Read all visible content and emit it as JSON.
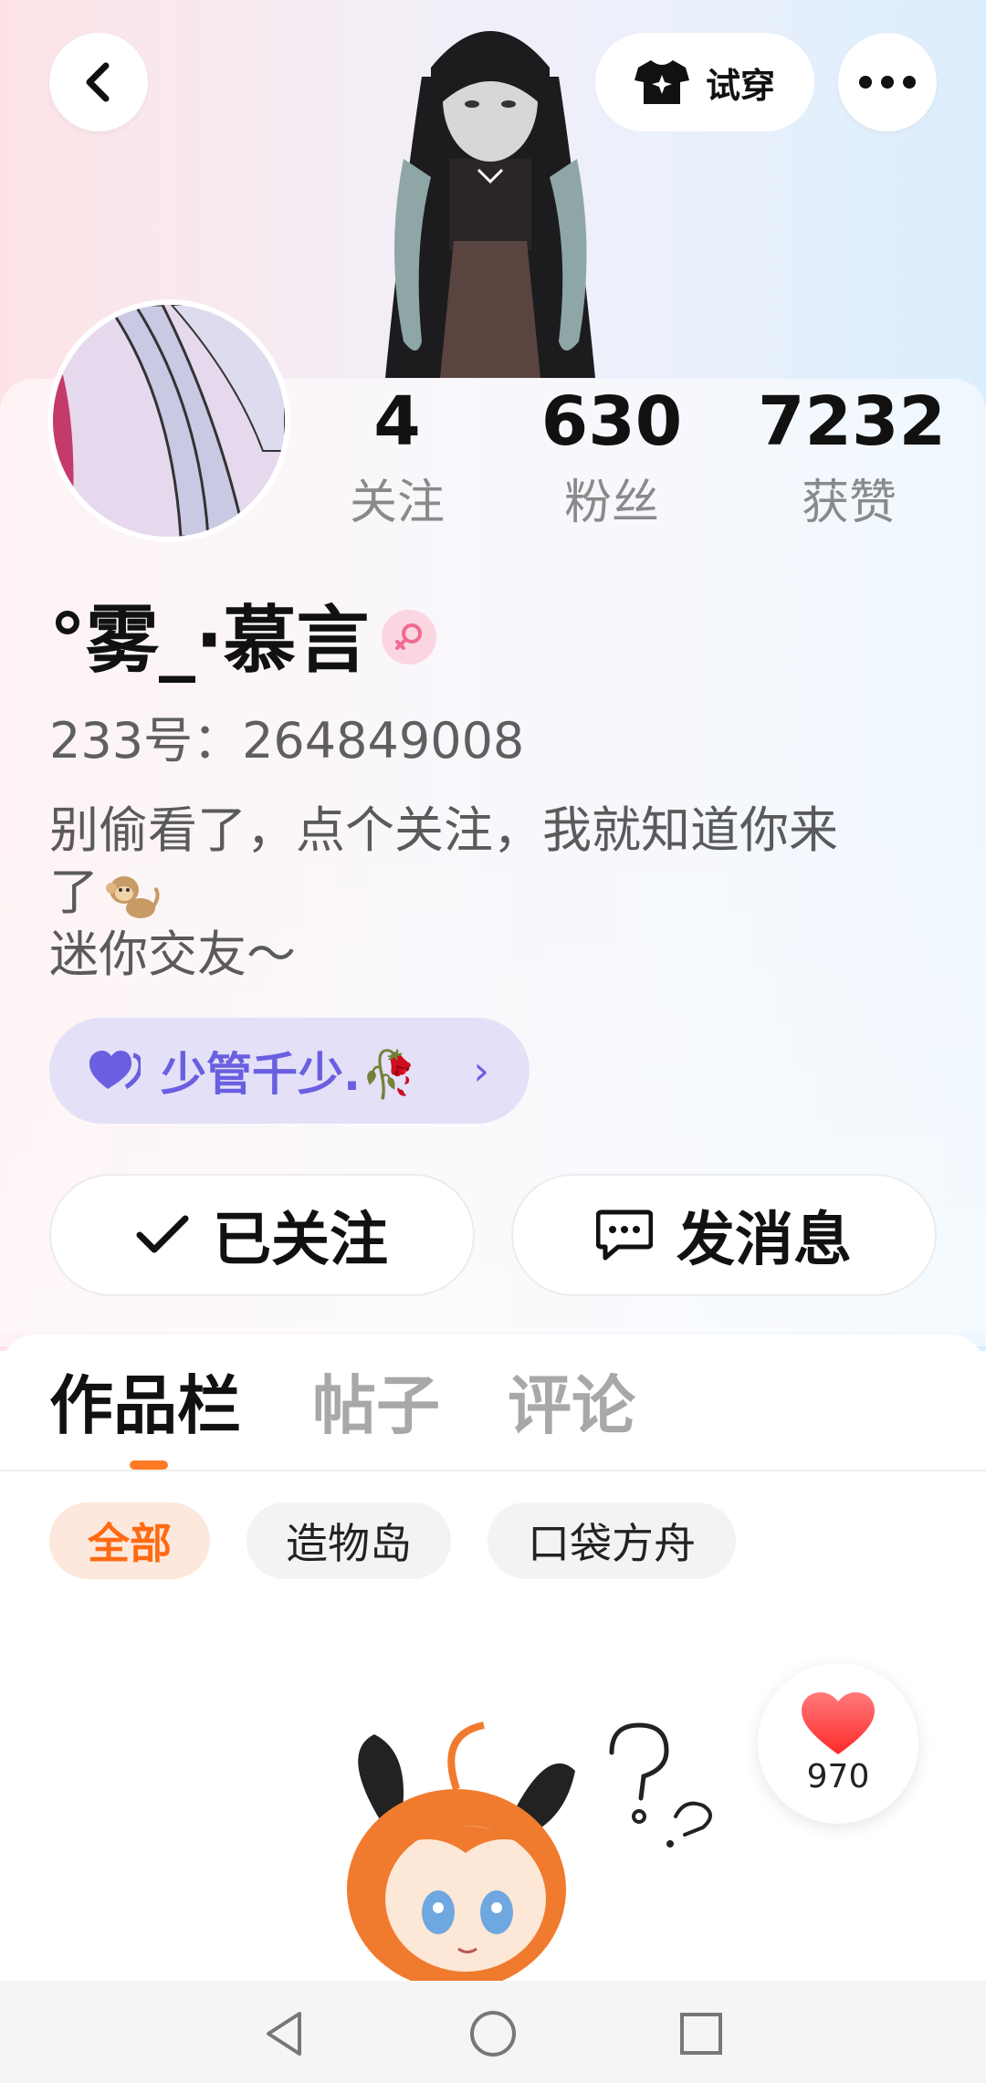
{
  "header": {
    "tryon_label": "试穿"
  },
  "stats": [
    {
      "value": "4",
      "label": "关注"
    },
    {
      "value": "630",
      "label": "粉丝"
    },
    {
      "value": "7232",
      "label": "获赞"
    }
  ],
  "profile": {
    "username": "°雾_·慕言",
    "uid": "233号：264849008",
    "bio_line1": "别偷看了，点个关注，我就知道你来",
    "bio_line2": "了",
    "bio_line3": "迷你交友～",
    "cp_name": "少管千少.🥀"
  },
  "actions": {
    "follow_label": "已关注",
    "message_label": "发消息"
  },
  "tabs": [
    {
      "label": "作品栏",
      "active": true
    },
    {
      "label": "帖子",
      "active": false
    },
    {
      "label": "评论",
      "active": false
    }
  ],
  "chips": [
    {
      "label": "全部",
      "active": true
    },
    {
      "label": "造物岛",
      "active": false
    },
    {
      "label": "口袋方舟",
      "active": false
    }
  ],
  "like": {
    "count": "970"
  },
  "colors": {
    "accent": "#ff6a13",
    "cp": "#6a5fe0",
    "like": "#ff3b3b"
  },
  "icons": [
    "back-icon",
    "tshirt-icon",
    "more-icon",
    "female-icon",
    "heart-icon",
    "check-icon",
    "chat-icon",
    "like-heart-icon",
    "nav-back-icon",
    "nav-home-icon",
    "nav-recents-icon"
  ]
}
